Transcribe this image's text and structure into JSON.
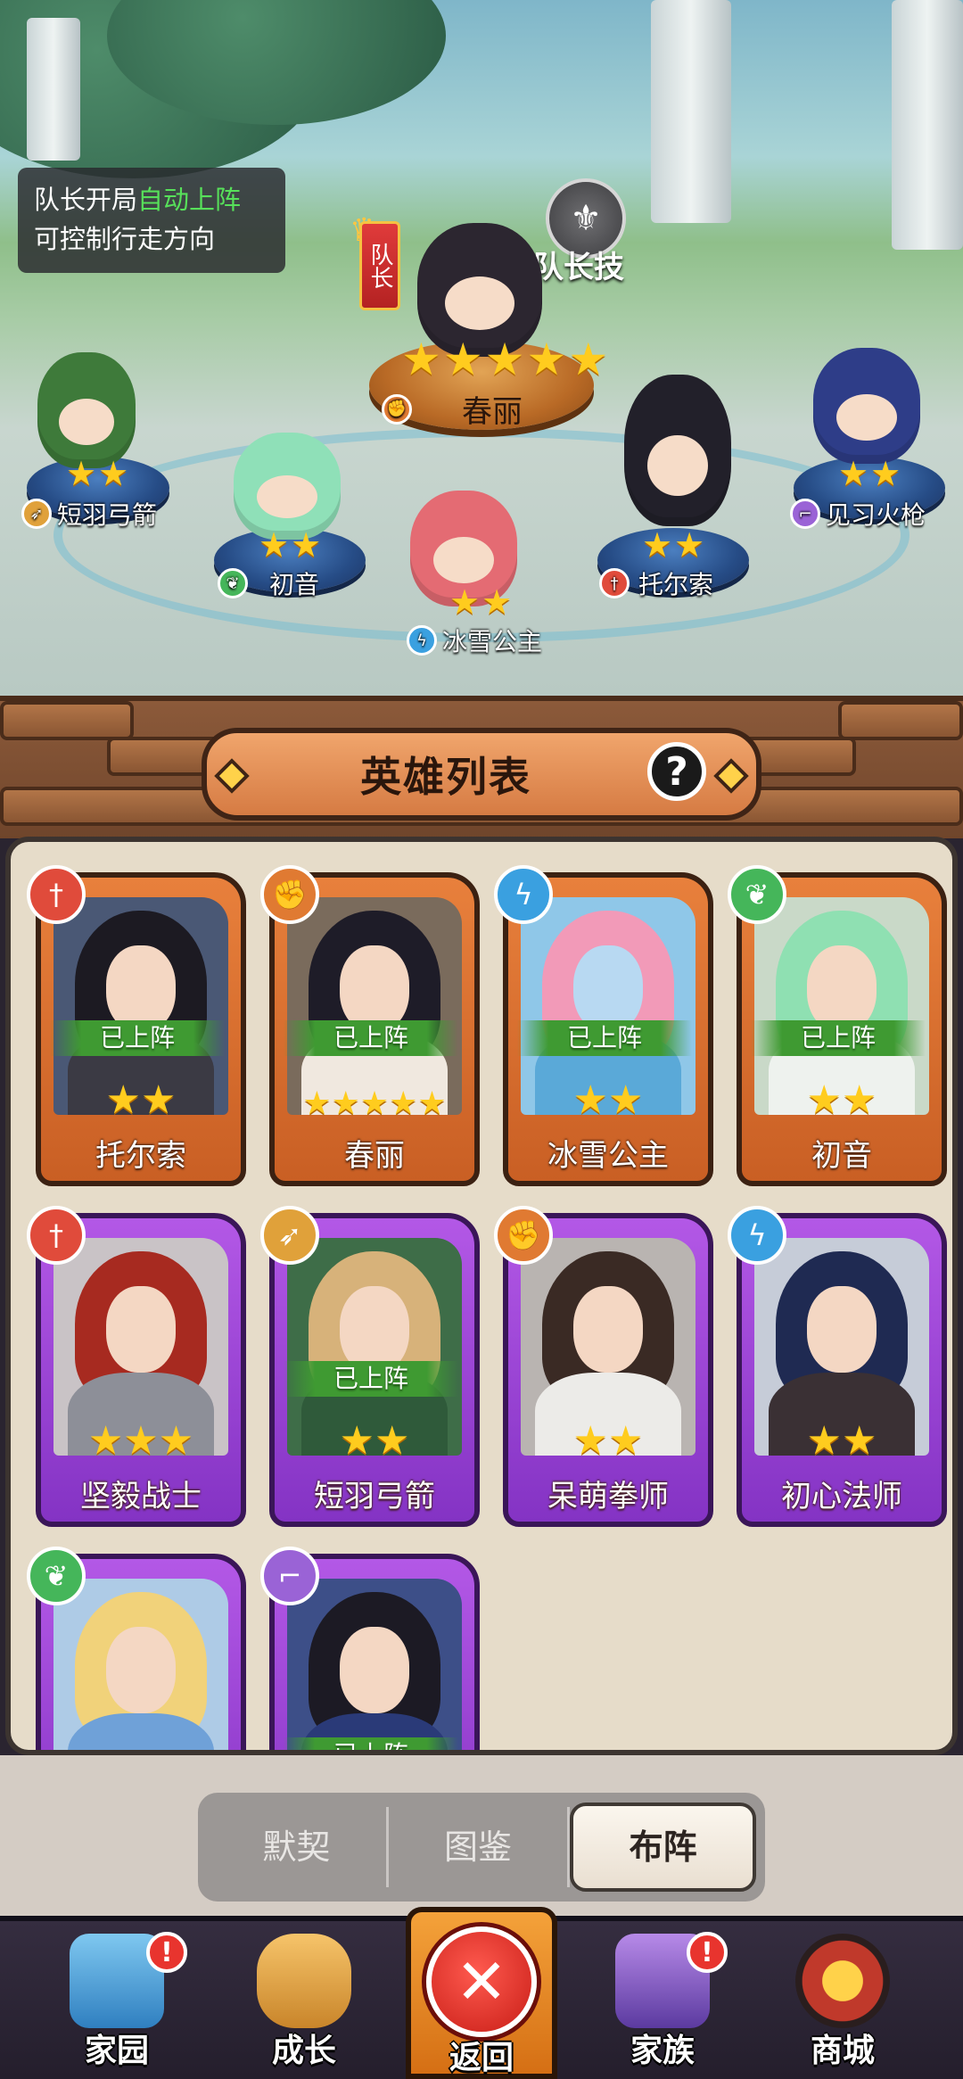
{
  "tip": {
    "line1_prefix": "队长开局",
    "line1_highlight": "自动上阵",
    "line2": "可控制行走方向"
  },
  "captain": {
    "badge": "队长",
    "skill_label": "队长技"
  },
  "formation": [
    {
      "name": "春丽",
      "stars": 5,
      "class": "fist"
    },
    {
      "name": "短羽弓箭",
      "stars": 2,
      "class": "archer"
    },
    {
      "name": "初音",
      "stars": 2,
      "class": "nature"
    },
    {
      "name": "冰雪公主",
      "stars": 2,
      "class": "mage"
    },
    {
      "name": "托尔索",
      "stars": 2,
      "class": "warrior"
    },
    {
      "name": "见习火枪",
      "stars": 2,
      "class": "gun"
    }
  ],
  "hero_list": {
    "title": "英雄列表",
    "help": "?",
    "deployed_label": "已上阵",
    "cards": [
      {
        "name": "托尔索",
        "stars": 2,
        "class": "warrior",
        "deployed": true,
        "frame": "orange"
      },
      {
        "name": "春丽",
        "stars": 5,
        "class": "fist",
        "deployed": true,
        "frame": "orange"
      },
      {
        "name": "冰雪公主",
        "stars": 2,
        "class": "mage",
        "deployed": true,
        "frame": "orange"
      },
      {
        "name": "初音",
        "stars": 2,
        "class": "nature",
        "deployed": true,
        "frame": "orange"
      },
      {
        "name": "坚毅战士",
        "stars": 3,
        "class": "warrior",
        "deployed": false,
        "frame": "purple"
      },
      {
        "name": "短羽弓箭",
        "stars": 2,
        "class": "archer",
        "deployed": true,
        "frame": "purple"
      },
      {
        "name": "呆萌拳师",
        "stars": 2,
        "class": "fist",
        "deployed": false,
        "frame": "purple"
      },
      {
        "name": "初心法师",
        "stars": 2,
        "class": "mage",
        "deployed": false,
        "frame": "purple"
      },
      {
        "name": "",
        "stars": 0,
        "class": "nature",
        "deployed": false,
        "frame": "purple"
      },
      {
        "name": "",
        "stars": 0,
        "class": "gun",
        "deployed": true,
        "frame": "purple"
      }
    ]
  },
  "tabs": {
    "items": [
      "默契",
      "图鉴",
      "布阵"
    ],
    "active": "布阵"
  },
  "nav": {
    "home": "家园",
    "growth": "成长",
    "back": "返回",
    "clan": "家族",
    "shop": "商城",
    "alert_glyph": "!"
  },
  "colors": {
    "orange_frame": "#c95f24",
    "purple_frame": "#8433c4",
    "deployed_green": "#3f9a32",
    "highlight_green": "#57e05a"
  }
}
